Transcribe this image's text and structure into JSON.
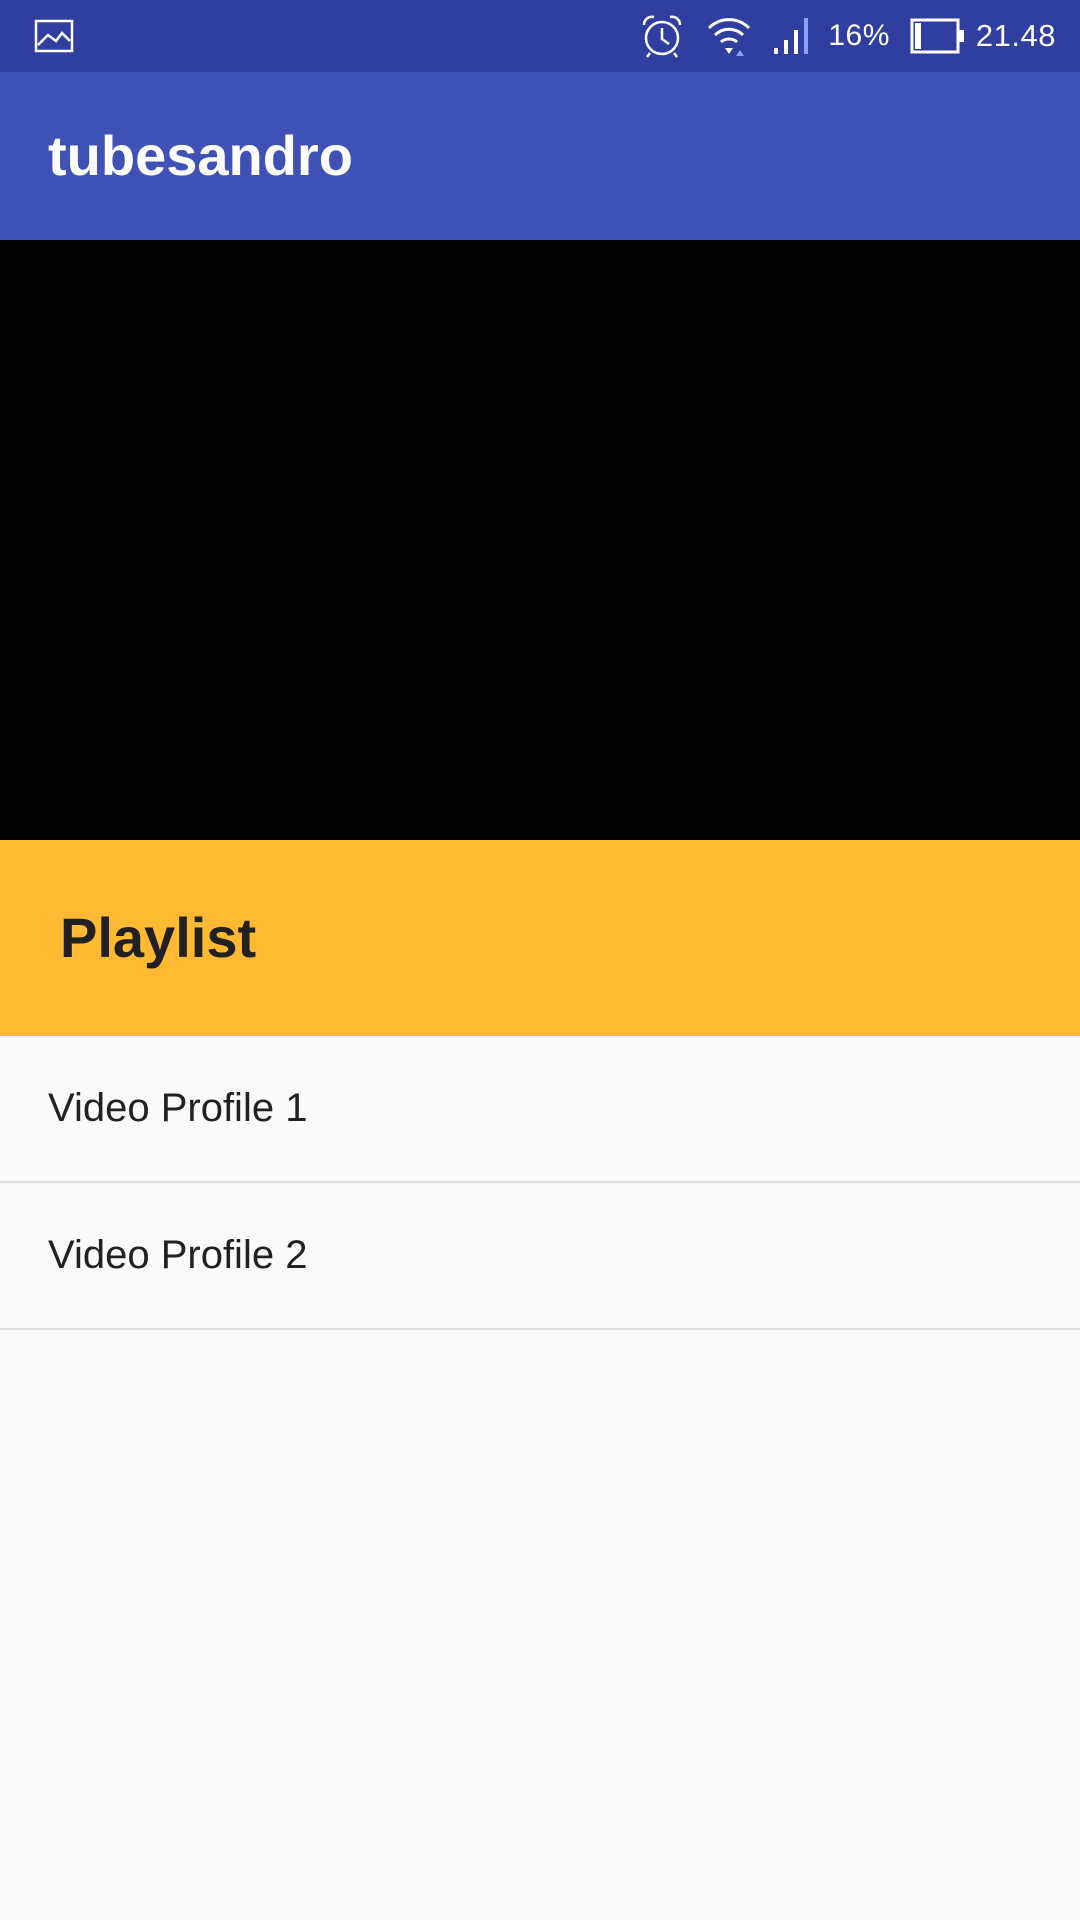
{
  "status_bar": {
    "left_icons": [
      "gallery-icon"
    ],
    "right_icons": [
      "alarm-icon",
      "wifi-icon",
      "signal-icon",
      "battery-icon"
    ],
    "battery_percent": "16%",
    "battery_level": 0.16,
    "time": "21.48"
  },
  "app_bar": {
    "title": "tubesandro",
    "color": "#3F51B5"
  },
  "video_player": {
    "color": "#000000"
  },
  "playlist": {
    "header": "Playlist",
    "header_color": "#FFB933",
    "items": [
      {
        "label": "Video Profile 1"
      },
      {
        "label": "Video Profile 2"
      }
    ]
  }
}
